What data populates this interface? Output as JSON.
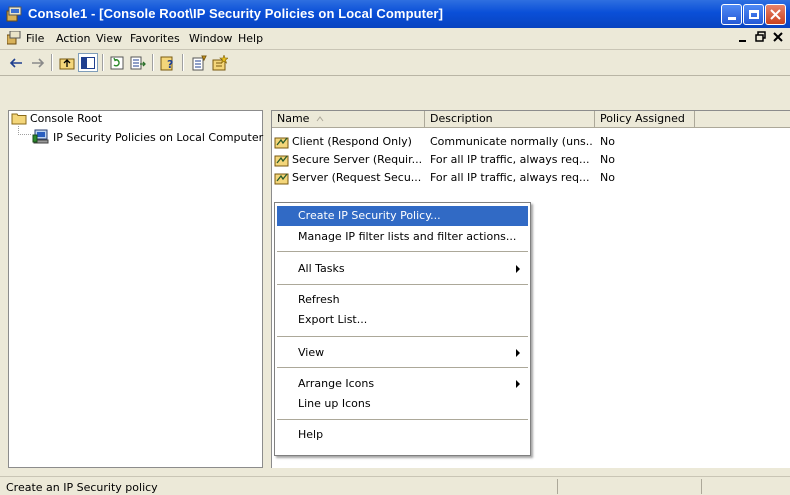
{
  "window": {
    "title": "Console1 - [Console Root\\IP Security Policies on Local Computer]"
  },
  "menubar": {
    "items": [
      "File",
      "Action",
      "View",
      "Favorites",
      "Window",
      "Help"
    ]
  },
  "tree": {
    "root_label": "Console Root",
    "child_label": "IP Security Policies on Local Computer"
  },
  "list": {
    "columns": [
      "Name",
      "Description",
      "Policy Assigned"
    ],
    "rows": [
      {
        "name": "Client (Respond Only)",
        "description": "Communicate normally (uns...",
        "assigned": "No"
      },
      {
        "name": "Secure Server (Requir...",
        "description": "For all IP traffic, always req...",
        "assigned": "No"
      },
      {
        "name": "Server (Request Secu...",
        "description": "For all IP traffic, always req...",
        "assigned": "No"
      }
    ]
  },
  "context_menu": {
    "items": [
      {
        "label": "Create IP Security Policy...",
        "selected": true
      },
      {
        "label": "Manage IP filter lists and filter actions..."
      },
      {
        "label": "All Tasks",
        "submenu": true
      },
      {
        "label": "Refresh"
      },
      {
        "label": "Export List..."
      },
      {
        "label": "View",
        "submenu": true
      },
      {
        "label": "Arrange Icons",
        "submenu": true
      },
      {
        "label": "Line up Icons"
      },
      {
        "label": "Help"
      }
    ]
  },
  "statusbar": {
    "text": "Create an IP Security policy"
  },
  "colors": {
    "titlebar": "#0a4fd8",
    "selection": "#316ac5",
    "chrome": "#ece9d8"
  }
}
